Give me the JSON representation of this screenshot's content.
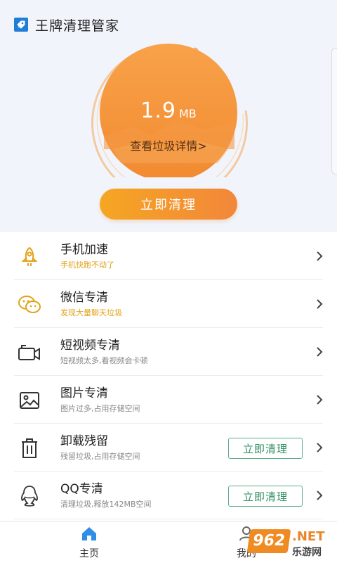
{
  "header": {
    "app_title": "王牌清理管家"
  },
  "gauge": {
    "size_value": "1.9",
    "size_unit": "MB",
    "detail_link": "查看垃圾详情>"
  },
  "clean_button_label": "立即清理",
  "items": [
    {
      "title": "手机加速",
      "subtitle": "手机快跑不动了",
      "icon": "rocket-icon"
    },
    {
      "title": "微信专清",
      "subtitle": "发现大量聊天垃圾",
      "icon": "wechat-icon"
    },
    {
      "title": "短视频专清",
      "subtitle": "短视频太多,看视频会卡顿",
      "icon": "video-camera-icon"
    },
    {
      "title": "图片专清",
      "subtitle": "图片过多,占用存储空间",
      "icon": "picture-icon"
    },
    {
      "title": "卸载残留",
      "subtitle": "残留垃圾,占用存储空间",
      "icon": "trash-icon",
      "button": "立即清理"
    },
    {
      "title": "QQ专清",
      "subtitle": "清理垃圾,释放142MB空间",
      "icon": "qq-icon",
      "button": "立即清理"
    }
  ],
  "bottom_nav": {
    "home_label": "主页",
    "mine_label": "我的"
  },
  "watermark": {
    "badge": "962",
    "net": ".NET",
    "cn": "乐游网"
  },
  "colors": {
    "accent_orange": "#f5a623",
    "gauge_orange": "#f59a3a",
    "green_button": "#2f8f64",
    "nav_blue": "#2f8fe6"
  }
}
